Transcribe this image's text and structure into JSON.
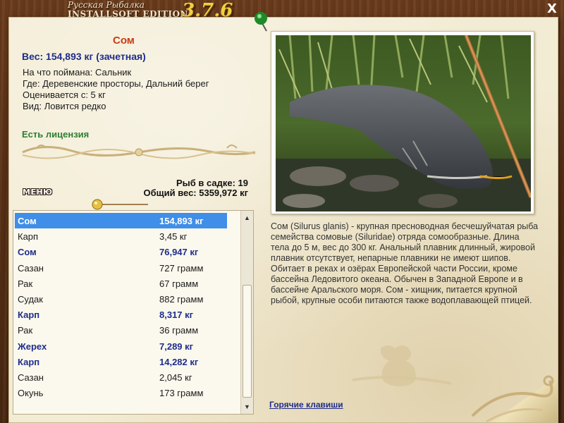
{
  "app": {
    "title_line1": "Русская Рыбалка",
    "edition": "INSTALLSOFT EDITION",
    "version": "3.7.6",
    "close_label": "X"
  },
  "fish_card": {
    "name": "Сом",
    "weight": "Вес: 154,893 кг (зачетная)",
    "details": [
      "На что поймана: Сальник",
      "Где: Деревенские просторы, Дальний берег",
      "Оценивается с: 5 кг",
      "Вид: Ловится редко"
    ],
    "license": "Есть лицензия"
  },
  "cage": {
    "count": "Рыб в садке: 19",
    "total": "Общий вес: 5359,972 кг"
  },
  "menu_button": "МЕНЮ",
  "catch_list": [
    {
      "name": "Сом",
      "weight": "154,893 кг",
      "trophy": true,
      "selected": true
    },
    {
      "name": "Карп",
      "weight": "3,45 кг",
      "trophy": false,
      "selected": false
    },
    {
      "name": "Сом",
      "weight": "76,947 кг",
      "trophy": true,
      "selected": false
    },
    {
      "name": "Сазан",
      "weight": "727 грамм",
      "trophy": false,
      "selected": false
    },
    {
      "name": "Рак",
      "weight": "67 грамм",
      "trophy": false,
      "selected": false
    },
    {
      "name": "Судак",
      "weight": "882 грамм",
      "trophy": false,
      "selected": false
    },
    {
      "name": "Карп",
      "weight": "8,317 кг",
      "trophy": true,
      "selected": false
    },
    {
      "name": "Рак",
      "weight": "36 грамм",
      "trophy": false,
      "selected": false
    },
    {
      "name": "Жерех",
      "weight": "7,289 кг",
      "trophy": true,
      "selected": false
    },
    {
      "name": "Карп",
      "weight": "14,282 кг",
      "trophy": true,
      "selected": false
    },
    {
      "name": "Сазан",
      "weight": "2,045 кг",
      "trophy": false,
      "selected": false
    },
    {
      "name": "Окунь",
      "weight": "173 грамм",
      "trophy": false,
      "selected": false
    }
  ],
  "description": "Сом (Silurus glanis) - крупная пресноводная бесчешуйчатая рыба семейства сомовые (Siluridae) отряда сомообразные. Длина тела до 5 м, вес до 300 кг. Анальный плавник длинный, жировой плавник отсутствует, непарные плавники не имеют шипов. Обитает в реках и озёрах Европейской части России, кроме бассейна Ледовитого океана. Обычен в Западной Европе и в бассейне Аральского моря. Сом - хищник, питается крупной рыбой, крупные особи питаются также водоплавающей птицей.",
  "hotkeys_link": "Горячие клавиши",
  "icons": {
    "close": "close-icon",
    "pin": "green-pin-icon",
    "float": "fishing-float-icon",
    "scroll_up": "scroll-up-arrow-icon",
    "scroll_down": "scroll-down-arrow-icon"
  },
  "colors": {
    "fish_name": "#c83a16",
    "trophy_text": "#1e2d8a",
    "license": "#2e7d32",
    "selection": "#3f8ee8",
    "version": "#f0d040",
    "paper": "#f3ecd4",
    "wood": "#5a3116"
  }
}
